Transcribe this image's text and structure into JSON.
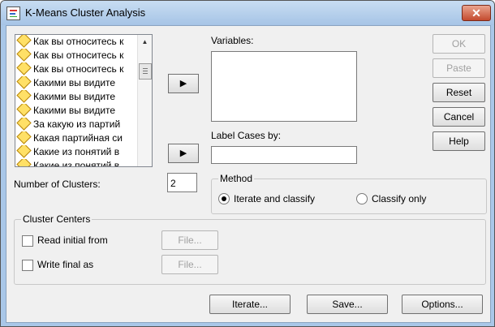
{
  "window": {
    "title": "K-Means Cluster Analysis",
    "close_glyph": "✕"
  },
  "variables_list": {
    "items": [
      "Как вы относитесь к",
      "Как вы относитесь к",
      "Как вы относитесь к",
      "Какими вы видите",
      "Какими вы видите",
      "Какими вы видите",
      "За какую из партий",
      "Какая партийная си",
      "Какие из понятий в",
      "Какие из понятий в"
    ]
  },
  "variables_label": "Variables:",
  "label_cases_label": "Label Cases by:",
  "number_of_clusters_label": "Number of Clusters:",
  "number_of_clusters_value": "2",
  "method": {
    "title": "Method",
    "iterate_label": "Iterate and classify",
    "classify_label": "Classify only",
    "selected": "iterate"
  },
  "cluster_centers": {
    "title": "Cluster Centers",
    "read_label": "Read initial from",
    "write_label": "Write final as",
    "file_button": "File..."
  },
  "buttons": {
    "ok": "OK",
    "paste": "Paste",
    "reset": "Reset",
    "cancel": "Cancel",
    "help": "Help",
    "iterate": "Iterate...",
    "save": "Save...",
    "options": "Options..."
  },
  "icons": {
    "move_arrow": "▶",
    "scroll_up": "▲",
    "list_item": "diamond-variable-icon"
  }
}
